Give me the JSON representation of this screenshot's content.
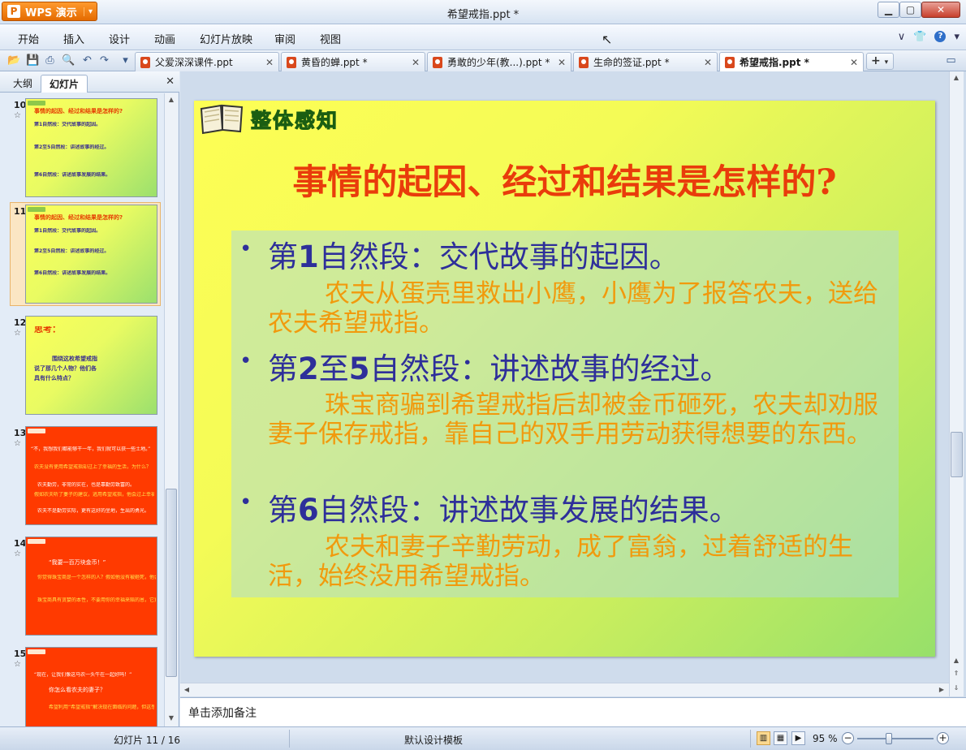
{
  "window": {
    "app_button": "WPS 演示",
    "title": "希望戒指.ppt *",
    "min": "▁",
    "max": "▢",
    "close": "✕"
  },
  "menu": {
    "items": [
      "开始",
      "插入",
      "设计",
      "动画",
      "幻灯片放映",
      "审阅",
      "视图"
    ]
  },
  "tabs": [
    {
      "label": "父爱深深课件.ppt",
      "active": false
    },
    {
      "label": "黄昏的蝉.ppt *",
      "active": false
    },
    {
      "label": "勇敢的少年(教...).ppt *",
      "active": false
    },
    {
      "label": "生命的签证.ppt *",
      "active": false
    },
    {
      "label": "希望戒指.ppt *",
      "active": true
    }
  ],
  "panel": {
    "tab_outline": "大纲",
    "tab_slides": "幻灯片",
    "close": "✕"
  },
  "thumbnails": [
    {
      "num": "10",
      "theme": "green",
      "lines": [
        "事情的起因、经过和结果是怎样的?",
        "第1自然段：交代故事的起因。",
        "第2至5自然段：讲述故事的经过。",
        "第6自然段：讲述故事发展的结果。"
      ]
    },
    {
      "num": "11",
      "theme": "green",
      "selected": true,
      "lines": [
        "事情的起因、经过和结果是怎样的?",
        "第1自然段：交代故事的起因。",
        "第2至5自然段：讲述故事的经过。",
        "第6自然段：讲述故事发展的结果。"
      ]
    },
    {
      "num": "12",
      "theme": "green",
      "lines": [
        "思考：",
        "围绕这枚希望戒指",
        "说了那几个人物？他们各",
        "具有什么特点？"
      ]
    },
    {
      "num": "13",
      "theme": "red",
      "lines": [
        "“不，我想我们都能够干一年，我们就可以获一些土地。”",
        "农夫没有使用希望戒指却过上了幸福的生活，为什么？",
        "农夫勤劳，非常的实在，也是靠勤劳致富的。",
        "假如农夫听了妻子的建议，逃用希望戒指，他会过上幸福的生活吗？",
        "农夫不是勤劳实际，更有这好的坐地，生出的勇光。"
      ]
    },
    {
      "num": "14",
      "theme": "red",
      "lines": [
        "“我要一百万块金币！”",
        "你觉得珠宝商是一个怎样的人？假如他没有被砸死，他会过上幸福的生活吗？",
        "珠宝商具有贪婪的本性，不要用你的幸福来赔的恩，它更会骗走人，成坏人，最终毁灭人。"
      ]
    },
    {
      "num": "15",
      "theme": "red",
      "lines": [
        "“现在，让我们像这马农一头牛在一起好吗！”",
        "你怎么看农夫的妻子？",
        "希望利用“希望戒指”解决现在面临的问题，但这想法不是..."
      ]
    }
  ],
  "slide": {
    "section_title": "整体感知",
    "title": "事情的起因、经过和结果是怎样的?",
    "bullets": [
      {
        "head_pre": "第",
        "head_num": "1",
        "head_post": "自然段：交代故事的起因。",
        "body": "农夫从蛋壳里救出小鹰，小鹰为了报答农夫，送给农夫希望戒指。"
      },
      {
        "head_pre": "第",
        "head_num": "2",
        "head_mid": "至",
        "head_num2": "5",
        "head_post": "自然段：讲述故事的经过。",
        "body": "珠宝商骗到希望戒指后却被金币砸死，农夫却劝服妻子保存戒指，靠自己的双手用劳动获得想要的东西。"
      },
      {
        "head_pre": "第",
        "head_num": "6",
        "head_post": "自然段：讲述故事发展的结果。",
        "body": "农夫和妻子辛勤劳动，成了富翁，过着舒适的生活，始终没用希望戒指。"
      }
    ],
    "bullet_char": "•"
  },
  "notes": {
    "placeholder": "单击添加备注"
  },
  "status": {
    "slide_pos": "幻灯片 11 / 16",
    "template": "默认设计模板",
    "zoom": "95 %",
    "zoom_fraction": 0.42
  },
  "colors": {
    "slide_title": "#e93c0b",
    "head": "#2e2f9a",
    "body": "#f19a0d"
  }
}
